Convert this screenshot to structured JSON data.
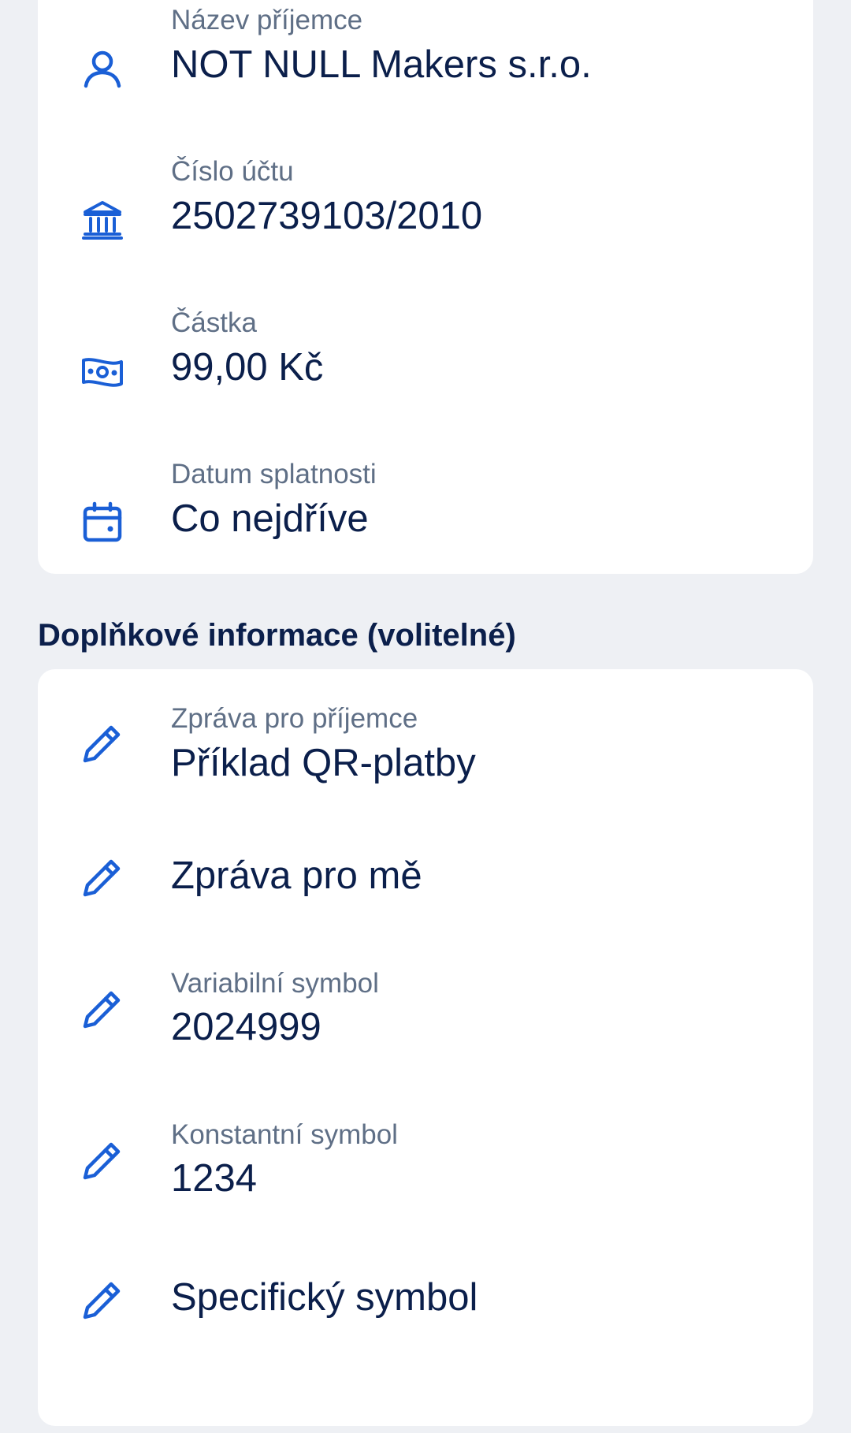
{
  "colors": {
    "background": "#eef0f4",
    "card": "#ffffff",
    "icon": "#1a5fd6",
    "label": "#5f6f86",
    "value": "#0b1f4b"
  },
  "payment": {
    "recipient": {
      "label": "Název příjemce",
      "value": "NOT NULL Makers s.r.o.",
      "icon": "person-icon"
    },
    "account": {
      "label": "Číslo účtu",
      "value": "2502739103/2010",
      "icon": "bank-icon"
    },
    "amount": {
      "label": "Částka",
      "value": "99,00 Kč",
      "icon": "banknote-icon"
    },
    "due_date": {
      "label": "Datum splatnosti",
      "value": "Co nejdříve",
      "icon": "calendar-icon"
    }
  },
  "additional": {
    "title": "Doplňkové informace (volitelné)",
    "message_for_recipient": {
      "label": "Zpráva pro příjemce",
      "value": "Příklad QR-platby",
      "icon": "pencil-icon"
    },
    "message_for_me": {
      "value": "Zpráva pro mě",
      "icon": "pencil-icon"
    },
    "variable_symbol": {
      "label": "Variabilní symbol",
      "value": "2024999",
      "icon": "pencil-icon"
    },
    "constant_symbol": {
      "label": "Konstantní symbol",
      "value": "1234",
      "icon": "pencil-icon"
    },
    "specific_symbol": {
      "value": "Specifický symbol",
      "icon": "pencil-icon"
    }
  }
}
